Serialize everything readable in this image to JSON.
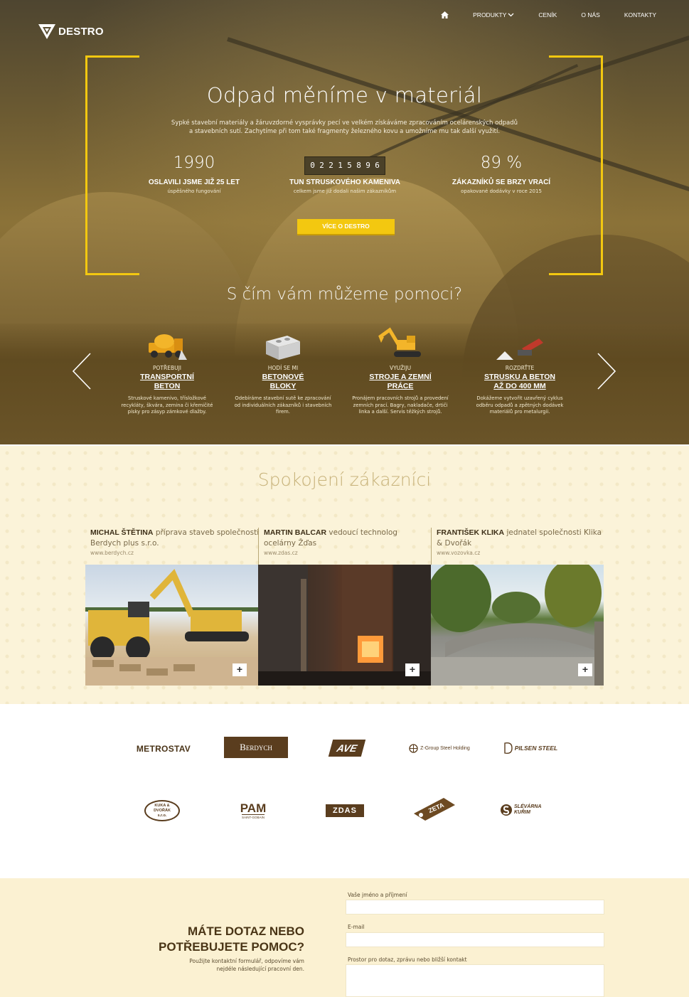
{
  "brand": {
    "name": "DESTRO"
  },
  "nav": {
    "home": "home",
    "products": "PRODUKTY",
    "pricing": "CENÍK",
    "about": "O NÁS",
    "contacts": "KONTAKTY"
  },
  "hero": {
    "title": "Odpad měníme v materiál",
    "subtitle_line1": "Sypké stavební materiály a žáruvzdorné vysprávky pecí ve velkém získáváme zpracováním ocelárenských odpadů",
    "subtitle_line2": "a stavebních sutí. Zachytíme při tom také fragmenty železného kovu a umožníme mu tak další využití.",
    "stats": [
      {
        "big": "1990",
        "label": "OSLAVILI JSME JIŽ 25 LET",
        "small": "úspěšného fungování"
      },
      {
        "digits": [
          "0",
          "2",
          "2",
          "1",
          "5",
          "8",
          "9",
          "6"
        ],
        "label": "TUN STRUSKOVÉHO KAMENIVA",
        "small": "celkem jsme již dodali našim zákazníkům"
      },
      {
        "big": "89 %",
        "label": "ZÁKAZNÍKŮ SE BRZY VRACÍ",
        "small": "opakované dodávky v roce 2015"
      }
    ],
    "cta": "VÍCE O DESTRO",
    "help_title": "S čím vám můžeme pomoci?"
  },
  "services": [
    {
      "icon": "concrete-mixer-icon",
      "pre": "POTŘEBUJI",
      "name1": "TRANSPORTNÍ",
      "name2": "BETON",
      "desc": "Struskové kamenivo, třísložkové recykláty, škvára, zemina či křemičité písky pro zásyp zámkové dlažby."
    },
    {
      "icon": "concrete-block-icon",
      "pre": "HODÍ SE MI",
      "name1": "BETONOVÉ",
      "name2": "BLOKY",
      "desc": "Odebíráme stavební sutě ke zpracování od individuálních zákazníků i stavebních firem."
    },
    {
      "icon": "excavator-icon",
      "pre": "VYUŽIJU",
      "name1": "STROJE A ZEMNÍ",
      "name2": "PRÁCE",
      "desc": "Pronájem pracovních strojů a provedení zemních prací. Bagry, nakladače, drtiči linka a další. Servis těžkých strojů."
    },
    {
      "icon": "crusher-icon",
      "pre": "ROZDRŤTE",
      "name1": "STRUSKU A BETON",
      "name2": "AŽ DO 400 mm",
      "desc": "Dokážeme vytvořit uzavřený cyklus odběru odpadů a zpětných dodávek materiálů pro metalurgii."
    }
  ],
  "testimonials": {
    "title": "Spokojení zákazníci",
    "items": [
      {
        "name": "MICHAL ŠTĚTINA",
        "role": "příprava staveb společnosti Berdych plus s.r.o.",
        "url": "www.berdych.cz"
      },
      {
        "name": "MARTIN BALCAR",
        "role": "vedoucí technolog ocelárny Žďas",
        "url": "www.zdas.cz"
      },
      {
        "name": "FRANTIŠEK KLIKA",
        "role": "jednatel společnosti Klika & Dvořák",
        "url": "www.vozovka.cz"
      }
    ],
    "plus": "+"
  },
  "logos": {
    "metrostav": "METROSTAV",
    "berdych": "Berdych",
    "ave": "AVE",
    "zgroup": "Z-Group Steel Holding",
    "pilsen": "PILSEN STEEL",
    "kuka": "KUKA & DVOŘÁK s.r.o.",
    "pam": "PAM",
    "pam_sub": "SAINT-GOBAIN",
    "zdas": "ZDAS",
    "zeta": "ZETA",
    "slevarna": "SLÉVÁRNA KUŘIM"
  },
  "contact": {
    "heading1": "MÁTE DOTAZ NEBO",
    "heading2": "POTŘEBUJETE POMOC?",
    "text1": "Použijte kontaktní formulář, odpovíme vám",
    "text2": "nejdéle následující pracovní den.",
    "name_label": "Vaše jméno a příjmení",
    "email_label": "E-mail",
    "message_label": "Prostor pro dotaz, zprávu nebo bližší kontakt"
  }
}
